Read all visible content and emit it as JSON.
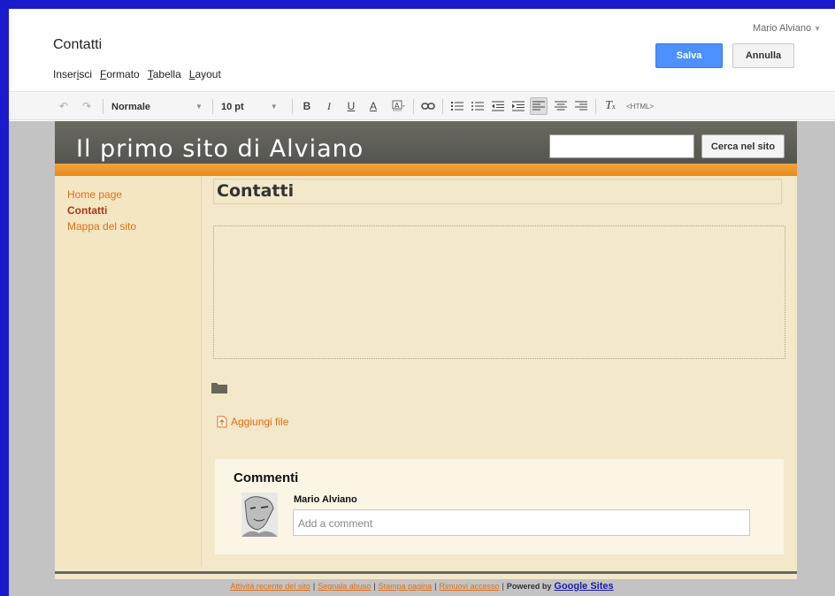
{
  "user": {
    "name": "Mario Alviano"
  },
  "editor": {
    "page_name": "Contatti",
    "menu": [
      {
        "pre": "Inser",
        "key": "i",
        "post": "sci"
      },
      {
        "pre": "",
        "key": "F",
        "post": "ormato"
      },
      {
        "pre": "",
        "key": "T",
        "post": "abella"
      },
      {
        "pre": "",
        "key": "L",
        "post": "ayout"
      }
    ],
    "save_label": "Salva",
    "cancel_label": "Annulla"
  },
  "toolbar": {
    "style_value": "Normale",
    "size_value": "10 pt",
    "bold": "B",
    "italic": "I",
    "underline": "U",
    "text_color": "A",
    "html_label": "<HTML>"
  },
  "site": {
    "title": "Il primo sito di Alviano",
    "search_button": "Cerca nel sito",
    "nav": [
      {
        "label": "Home page",
        "current": false
      },
      {
        "label": "Contatti",
        "current": true
      },
      {
        "label": "Mappa del sito",
        "current": false
      }
    ],
    "page_title": "Contatti",
    "attach_label": "Aggiungi file",
    "comments": {
      "title": "Commenti",
      "author": "Mario Alviano",
      "placeholder": "Add a comment"
    }
  },
  "footer": {
    "links": [
      "Attività recente del sito",
      "Segnala abuso",
      "Stampa pagina",
      "Rimuovi accesso"
    ],
    "powered_by": "Powered by",
    "google_sites": "Google Sites"
  },
  "colors": {
    "accent_blue": "#4d90fe",
    "site_link": "#e06f15",
    "orange_bar": "#f2a23c",
    "site_bg": "#f2e7c8"
  }
}
